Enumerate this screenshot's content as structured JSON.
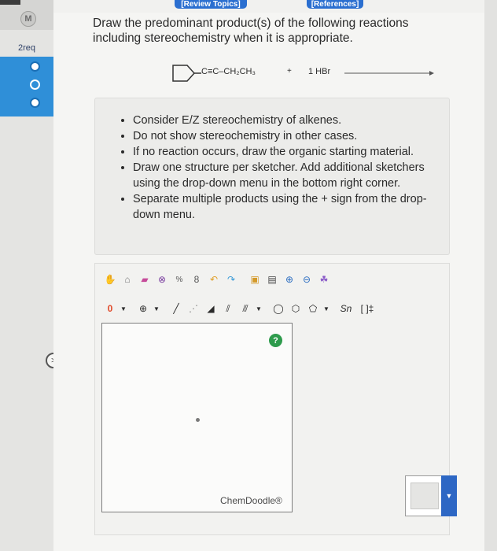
{
  "sidebar": {
    "badge": "M",
    "item_label": "2req"
  },
  "tabs": {
    "review": "[Review Topics]",
    "references": "[References]"
  },
  "question": {
    "text": "Draw the predominant product(s) of the following reactions including stereochemistry when it is appropriate."
  },
  "reaction": {
    "substrate": "C≡C–CH₂CH₃",
    "plus": "+",
    "reagent": "1 HBr"
  },
  "hints": [
    "Consider E/Z stereochemistry of alkenes.",
    "Do not show stereochemistry in other cases.",
    "If no reaction occurs, draw the organic starting material.",
    "Draw one structure per sketcher. Add additional sketchers using the drop-down menu in the bottom right corner.",
    "Separate multiple products using the + sign from the drop-down menu."
  ],
  "toolbar": {
    "charge_label": "0",
    "plus_label": "⊕",
    "ring_label": "[ ]‡",
    "sn_label": "Sn"
  },
  "canvas": {
    "help": "?",
    "brand": "ChemDoodle®"
  },
  "colors": {
    "accent_blue": "#2b6fd0",
    "help_green": "#2e9b4c"
  }
}
